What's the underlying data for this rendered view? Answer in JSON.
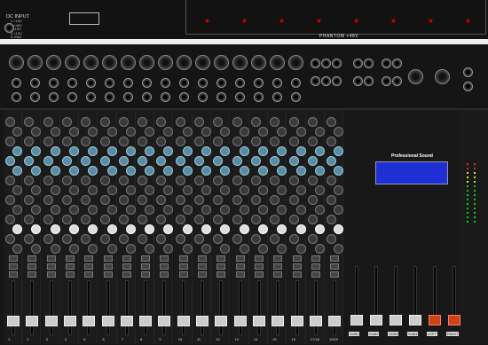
{
  "rear": {
    "dc_input_title": "DC INPUT",
    "dc_lines": "1 +15V\n2 +48V\n3 -15V\n4 +15V\n5 GND",
    "phantom_label": "PHANTOM +48V"
  },
  "surface": {
    "brand_title": "Professional Sound",
    "channels": [
      "1",
      "2",
      "3",
      "4",
      "5",
      "6",
      "7",
      "8",
      "9",
      "10",
      "11",
      "12",
      "13",
      "14",
      "15",
      "16",
      "17/18",
      "19/20"
    ],
    "master_labels": [
      "SUB1",
      "SUB2",
      "SUB3",
      "SUB4",
      "LEFT",
      "RIGHT"
    ]
  },
  "colors": {
    "led": "#d10000",
    "screen": "#1f2fd6",
    "fader_main": "#c41"
  }
}
